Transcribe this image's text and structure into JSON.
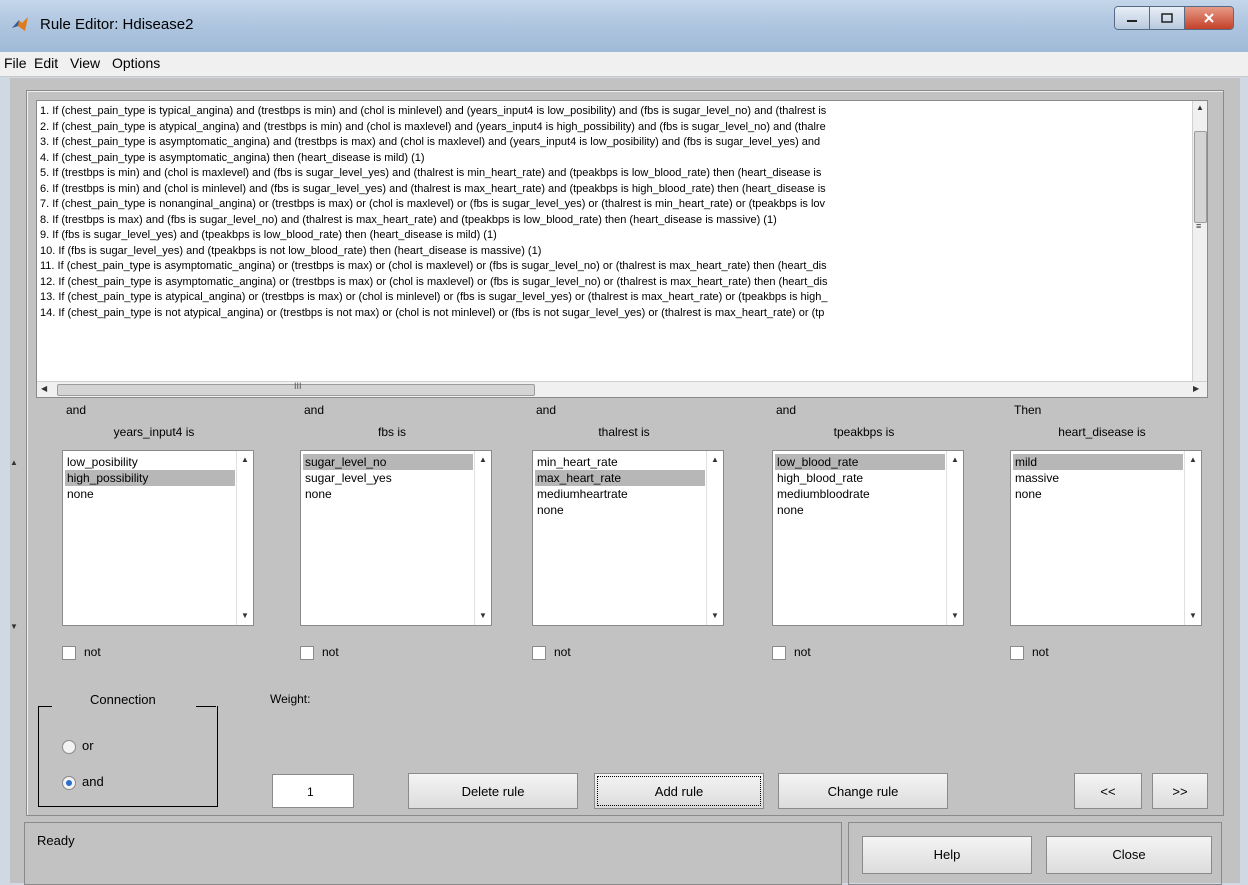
{
  "window": {
    "title": "Rule Editor: Hdisease2"
  },
  "menu": [
    "File",
    "Edit",
    "View",
    "Options"
  ],
  "rules": [
    "1. If (chest_pain_type is typical_angina) and (trestbps is min) and (chol is minlevel) and (years_input4 is low_posibility) and (fbs is sugar_level_no) and (thalrest is",
    "2. If (chest_pain_type is atypical_angina) and (trestbps is min) and (chol is maxlevel) and (years_input4 is high_possibility) and (fbs is sugar_level_no) and (thalre",
    "3. If (chest_pain_type is asymptomatic_angina) and (trestbps is max) and (chol is maxlevel) and (years_input4 is low_posibility) and (fbs is sugar_level_yes) and",
    "4. If (chest_pain_type is asymptomatic_angina) then (heart_disease is mild) (1)",
    "5. If (trestbps is min) and (chol is maxlevel) and (fbs is sugar_level_yes) and (thalrest is min_heart_rate) and (tpeakbps is low_blood_rate) then (heart_disease is",
    "6. If (trestbps is min) and (chol is minlevel) and (fbs is sugar_level_yes) and (thalrest is max_heart_rate) and (tpeakbps is high_blood_rate) then (heart_disease is",
    "7. If (chest_pain_type is nonanginal_angina) or (trestbps is max) or (chol is maxlevel) or (fbs is sugar_level_yes) or (thalrest is min_heart_rate) or (tpeakbps is lov",
    "8. If (trestbps is max) and (fbs is sugar_level_no) and (thalrest is max_heart_rate) and (tpeakbps is low_blood_rate) then (heart_disease is massive) (1)",
    "9. If (fbs is sugar_level_yes) and (tpeakbps is low_blood_rate) then (heart_disease is mild) (1)",
    "10. If (fbs is sugar_level_yes) and (tpeakbps is not low_blood_rate) then (heart_disease is massive) (1)",
    "11. If (chest_pain_type is asymptomatic_angina) or (trestbps is max) or (chol is maxlevel) or (fbs is sugar_level_no) or (thalrest is max_heart_rate) then (heart_dis",
    "12. If (chest_pain_type is asymptomatic_angina) or (trestbps is max) or (chol is maxlevel) or (fbs is sugar_level_no) or (thalrest is max_heart_rate) then (heart_dis",
    "13. If (chest_pain_type is atypical_angina) or (trestbps is max) or (chol is minlevel) or (fbs is sugar_level_yes) or (thalrest is max_heart_rate) or (tpeakbps is high_",
    "14. If (chest_pain_type is not atypical_angina) or (trestbps is not max) or (chol is not minlevel) or (fbs is not sugar_level_yes) or (thalrest is max_heart_rate) or (tp"
  ],
  "columns": [
    {
      "prefix": "and",
      "var": "years_input4 is",
      "options": [
        "low_posibility",
        "high_possibility",
        "none"
      ],
      "selected": 1,
      "not_label": "not"
    },
    {
      "prefix": "and",
      "var": "fbs is",
      "options": [
        "sugar_level_no",
        "sugar_level_yes",
        "none"
      ],
      "selected": 0,
      "not_label": "not"
    },
    {
      "prefix": "and",
      "var": "thalrest is",
      "options": [
        "min_heart_rate",
        "max_heart_rate",
        "mediumheartrate",
        "none"
      ],
      "selected": 1,
      "not_label": "not"
    },
    {
      "prefix": "and",
      "var": "tpeakbps is",
      "options": [
        "low_blood_rate",
        "high_blood_rate",
        "mediumbloodrate",
        "none"
      ],
      "selected": 0,
      "not_label": "not"
    },
    {
      "prefix": "Then",
      "var": "heart_disease is",
      "options": [
        "mild",
        "massive",
        "none"
      ],
      "selected": 0,
      "not_label": "not"
    }
  ],
  "connection": {
    "title": "Connection",
    "or_label": "or",
    "and_label": "and",
    "selected": "and"
  },
  "weight": {
    "label": "Weight:",
    "value": "1"
  },
  "buttons": {
    "delete": "Delete rule",
    "add": "Add rule",
    "change": "Change rule",
    "prev": "<<",
    "next": ">>",
    "help": "Help",
    "close": "Close"
  },
  "status": {
    "text": "Ready"
  },
  "colors": {
    "title_bar": "#aec5df",
    "panel": "#c2c2c2",
    "selection": "#b7b7b7",
    "close_button": "#c4412a"
  }
}
